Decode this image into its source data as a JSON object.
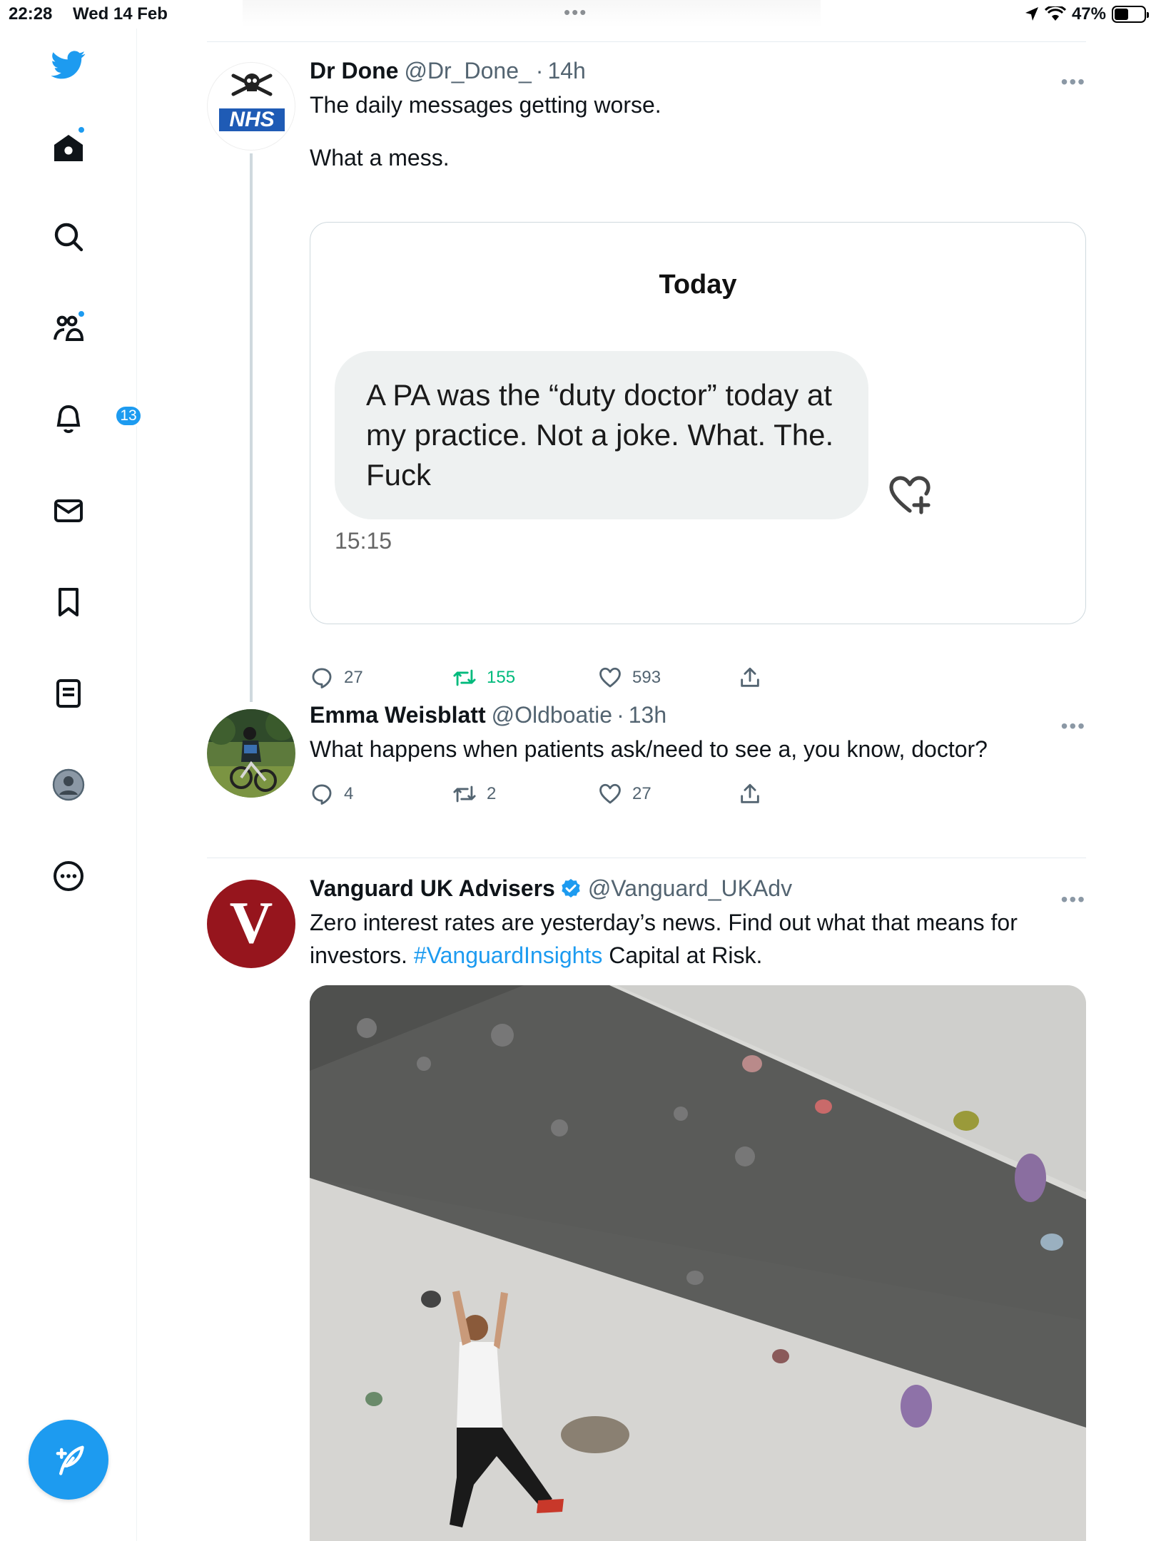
{
  "status_bar": {
    "time": "22:28",
    "date": "Wed 14 Feb",
    "battery": "47%",
    "battery_level": 0.47
  },
  "sidebar": {
    "notifications_badge": "13"
  },
  "colors": {
    "accent": "#1d9bf0",
    "retweet_green": "#00ba7c",
    "secondary_text": "#536471",
    "vanguard_red": "#96151d"
  },
  "tweets": [
    {
      "name": "Dr Done",
      "handle": "@Dr_Done_",
      "sep": "·",
      "time": "14h",
      "text_line1": "The daily messages getting worse.",
      "text_line2": "What a mess.",
      "avatar_label": "NHS",
      "embed": {
        "day": "Today",
        "message": "A PA was the “duty doctor” today at my practice. Not a joke. What. The. Fuck",
        "time": "15:15"
      },
      "replies": "27",
      "retweets": "155",
      "likes": "593"
    },
    {
      "name": "Emma Weisblatt",
      "handle": "@Oldboatie",
      "sep": "·",
      "time": "13h",
      "text": "What happens when patients ask/need to see a, you know, doctor?",
      "replies": "4",
      "retweets": "2",
      "likes": "27"
    },
    {
      "name": "Vanguard UK Advisers",
      "handle": "@Vanguard_UKAdv",
      "verified": true,
      "text_before": "Zero interest rates are yesterday’s news. Find out what that means for investors. ",
      "hashtag": "#VanguardInsights",
      "text_after": " Capital at Risk.",
      "avatar_label": "V"
    }
  ]
}
